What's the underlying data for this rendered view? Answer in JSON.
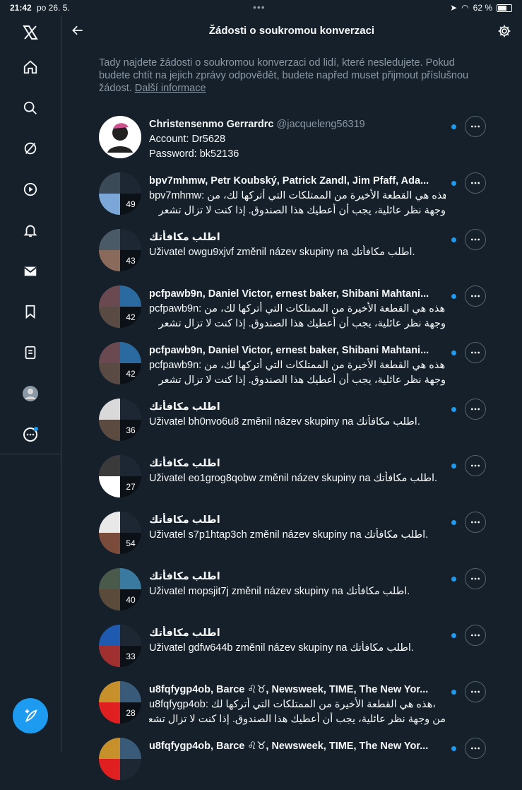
{
  "status_bar": {
    "time": "21:42",
    "date": "po 26. 5.",
    "battery": "62 %"
  },
  "header": {
    "title": "Žádosti o soukromou konverzaci"
  },
  "info": {
    "text": "Tady najdete žádosti o soukromou konverzaci od lidí, které nesledujete. Pokud budete chtít na jejich zprávy odpovědět, budete napřed muset přijmout příslušnou žádost.",
    "link": "Další informace"
  },
  "requests": [
    {
      "title": "Christensenmo Gerrardrc",
      "handle": "@jacqueleng56319",
      "lines": [
        "Account: Dr5628",
        "Password: bk52136"
      ],
      "count": ""
    },
    {
      "title": "bpv7mhmw, Petr Koubský, Patrick Zandl, Jim Pfaff, Ada...",
      "handle": "",
      "lines": [
        "bpv7mhmw: هذه هي القطعة الأخيرة من الممتلكات التي أتركها لك، من",
        "وجهة نظر عائلية، يجب أن أعطيك هذا الصندوق. إذا كنت لا تزال تشعر"
      ],
      "count": "49"
    },
    {
      "title": "اطلب مكافأتك",
      "handle": "",
      "lines": [
        "Uživatel owgu9xjvf změnil název skupiny na اطلب مكافأتك."
      ],
      "count": "43"
    },
    {
      "title": "pcfpawb9n, Daniel Victor, ernest baker, Shibani Mahtani...",
      "handle": "",
      "lines": [
        "pcfpawb9n: هذه هي القطعة الأخيرة من الممتلكات التي أتركها لك، من",
        "وجهة نظر عائلية، يجب أن أعطيك هذا الصندوق. إذا كنت لا تزال تشعر"
      ],
      "count": "42"
    },
    {
      "title": "pcfpawb9n, Daniel Victor, ernest baker, Shibani Mahtani...",
      "handle": "",
      "lines": [
        "pcfpawb9n: هذه هي القطعة الأخيرة من الممتلكات التي أتركها لك، من",
        "وجهة نظر عائلية، يجب أن أعطيك هذا الصندوق. إذا كنت لا تزال تشعر"
      ],
      "count": "42"
    },
    {
      "title": "اطلب مكافأتك",
      "handle": "",
      "lines": [
        "Uživatel bh0nvo6u8 změnil název skupiny na اطلب مكافأتك."
      ],
      "count": "36"
    },
    {
      "title": "اطلب مكافأتك",
      "handle": "",
      "lines": [
        "Uživatel eo1grog8qobw změnil název skupiny na اطلب مكافأتك."
      ],
      "count": "27"
    },
    {
      "title": "اطلب مكافأتك",
      "handle": "",
      "lines": [
        "Uživatel s7p1htap3ch změnil název skupiny na اطلب مكافأتك."
      ],
      "count": "54"
    },
    {
      "title": "اطلب مكافأتك",
      "handle": "",
      "lines": [
        "Uživatel mopsjit7j změnil název skupiny na اطلب مكافأتك."
      ],
      "count": "40"
    },
    {
      "title": "اطلب مكافأتك",
      "handle": "",
      "lines": [
        "Uživatel gdfw644b změnil název skupiny na اطلب مكافأتك."
      ],
      "count": "33"
    },
    {
      "title": "u8fqfygp4ob, Barce ♌︎♉︎, Newsweek, TIME, The New Yor...",
      "handle": "",
      "lines": [
        "u8fqfygp4ob: هذه هي القطعة الأخيرة من الممتلكات التي أتركها لك،",
        "من وجهة نظر عائلية، يجب أن أعطيك هذا الصندوق. إذا كنت لا تزال تشعر"
      ],
      "count": "28"
    },
    {
      "title": "u8fqfygp4ob, Barce ♌︎♉︎, Newsweek, TIME, The New Yor...",
      "handle": "",
      "lines": [],
      "count": ""
    }
  ],
  "colors": {
    "background": "#15202b",
    "accent": "#1d9bf0",
    "muted": "#8b98a5"
  }
}
